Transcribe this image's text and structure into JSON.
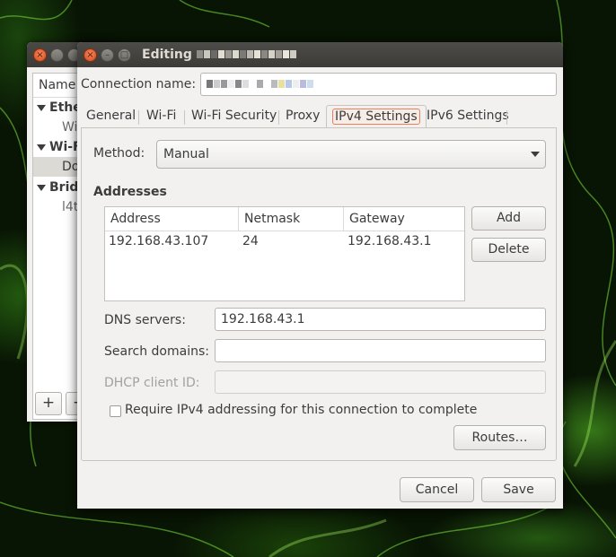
{
  "back_window": {
    "list_header": "Name",
    "groups": [
      {
        "label": "Ethe",
        "items": [
          "Wi"
        ]
      },
      {
        "label": "Wi-F",
        "items": [
          "Do"
        ]
      },
      {
        "label": "Bridg",
        "items": [
          "l4t"
        ]
      }
    ],
    "add_label": "+",
    "remove_label": "−"
  },
  "dialog": {
    "title_prefix": "Editing",
    "connection_name_label": "Connection name:",
    "tabs": [
      "General",
      "Wi-Fi",
      "Wi-Fi Security",
      "Proxy",
      "IPv4 Settings",
      "IPv6 Settings"
    ],
    "active_tab": "IPv4 Settings",
    "method_label": "Method:",
    "method_value": "Manual",
    "addresses_heading": "Addresses",
    "columns": [
      "Address",
      "Netmask",
      "Gateway"
    ],
    "rows": [
      {
        "address": "192.168.43.107",
        "netmask": "24",
        "gateway": "192.168.43.1"
      }
    ],
    "add_label": "Add",
    "delete_label": "Delete",
    "dns_label": "DNS servers:",
    "dns_value": "192.168.43.1",
    "search_label": "Search domains:",
    "search_value": "",
    "dhcp_label": "DHCP client ID:",
    "dhcp_value": "",
    "require_label": "Require IPv4 addressing for this connection to complete",
    "require_checked": false,
    "routes_label": "Routes…",
    "cancel_label": "Cancel",
    "save_label": "Save"
  }
}
